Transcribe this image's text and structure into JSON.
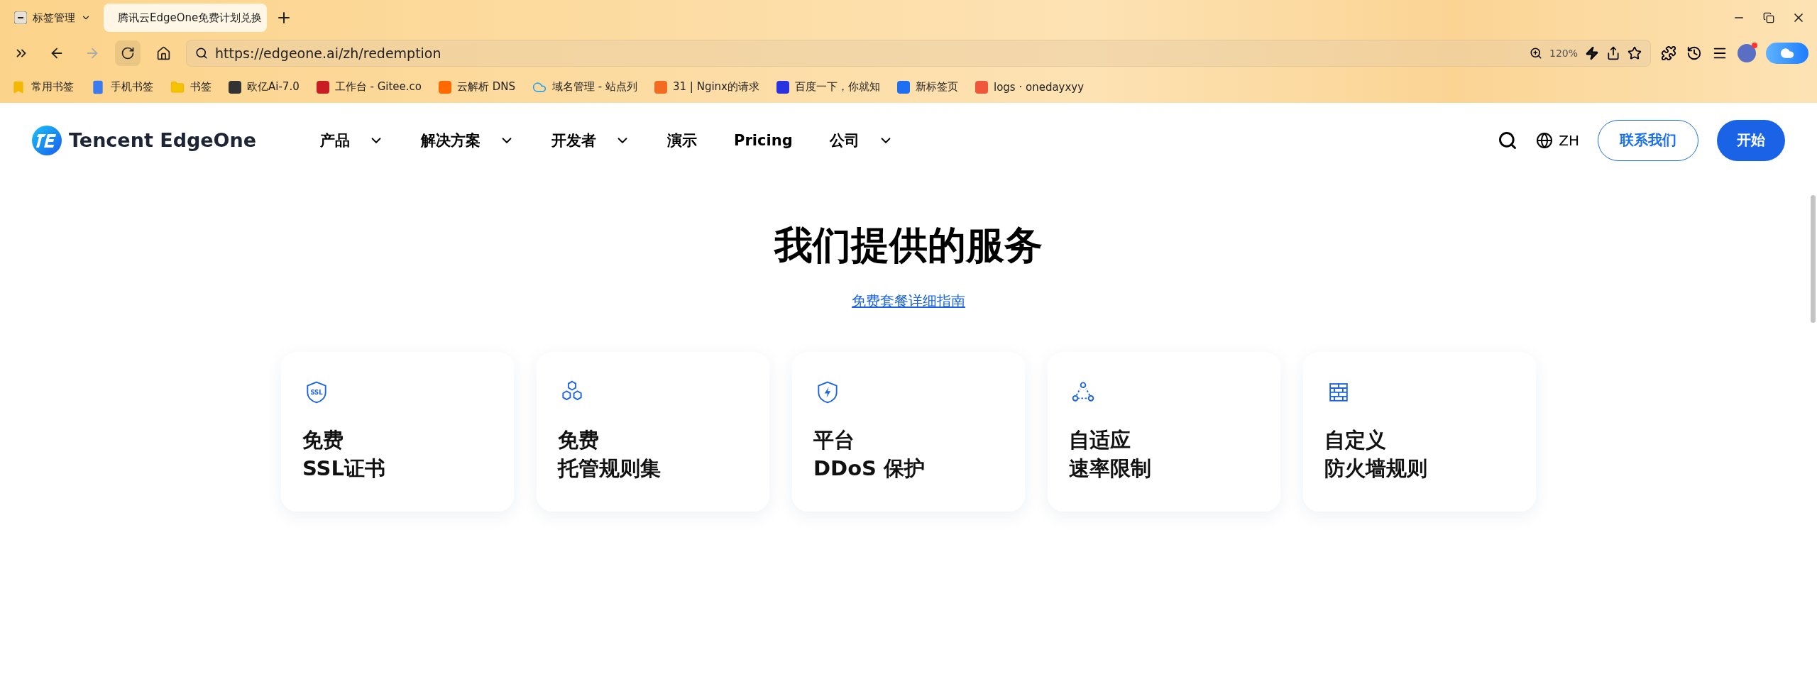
{
  "browser": {
    "tabs": [
      {
        "label": "标签管理",
        "selected": false,
        "kind": "group"
      },
      {
        "label": "腾讯云EdgeOne免费计划兑换",
        "selected": true,
        "kind": "page"
      }
    ],
    "url": "https://edgeone.ai/zh/redemption",
    "zoom": "120%",
    "bookmarks": [
      {
        "label": "常用书签",
        "kind": "bookmark"
      },
      {
        "label": "手机书签",
        "kind": "phone"
      },
      {
        "label": "书签",
        "kind": "folder"
      },
      {
        "label": "欧亿Ai-7.0",
        "kind": "site",
        "color": "#333333"
      },
      {
        "label": "工作台 - Gitee.co",
        "kind": "site",
        "color": "#c71d23"
      },
      {
        "label": "云解析 DNS",
        "kind": "site",
        "color": "#ff6a00"
      },
      {
        "label": "域名管理 - 站点列",
        "kind": "cloud",
        "color": "#2aa3ef"
      },
      {
        "label": "31 | Nginx的请求",
        "kind": "site",
        "color": "#f26b21"
      },
      {
        "label": "百度一下，你就知",
        "kind": "site",
        "color": "#2932e1"
      },
      {
        "label": "新标签页",
        "kind": "site",
        "color": "#1e6ff1"
      },
      {
        "label": "logs · onedayxyy",
        "kind": "site",
        "color": "#f0563a"
      }
    ]
  },
  "header": {
    "brand": "Tencent EdgeOne",
    "nav": [
      {
        "label": "产品",
        "dropdown": true
      },
      {
        "label": "解决方案",
        "dropdown": true
      },
      {
        "label": "开发者",
        "dropdown": true
      },
      {
        "label": "演示",
        "dropdown": false
      },
      {
        "label": "Pricing",
        "dropdown": false
      },
      {
        "label": "公司",
        "dropdown": true
      }
    ],
    "language": "ZH",
    "contact_button": "联系我们",
    "start_button": "开始"
  },
  "main": {
    "title": "我们提供的服务",
    "guide_link": "免费套餐详细指南",
    "cards": [
      {
        "kind": "ssl",
        "badge": "SSL",
        "line1": "免费",
        "line2": "SSL证书"
      },
      {
        "kind": "hexagons",
        "line1": "免费",
        "line2": "托管规则集"
      },
      {
        "kind": "shield-bolt",
        "line1": "平台",
        "line2": "DDoS 保护"
      },
      {
        "kind": "nodes",
        "line1": "自适应",
        "line2": "速率限制"
      },
      {
        "kind": "wall",
        "line1": "自定义",
        "line2": "防火墙规则"
      }
    ]
  }
}
